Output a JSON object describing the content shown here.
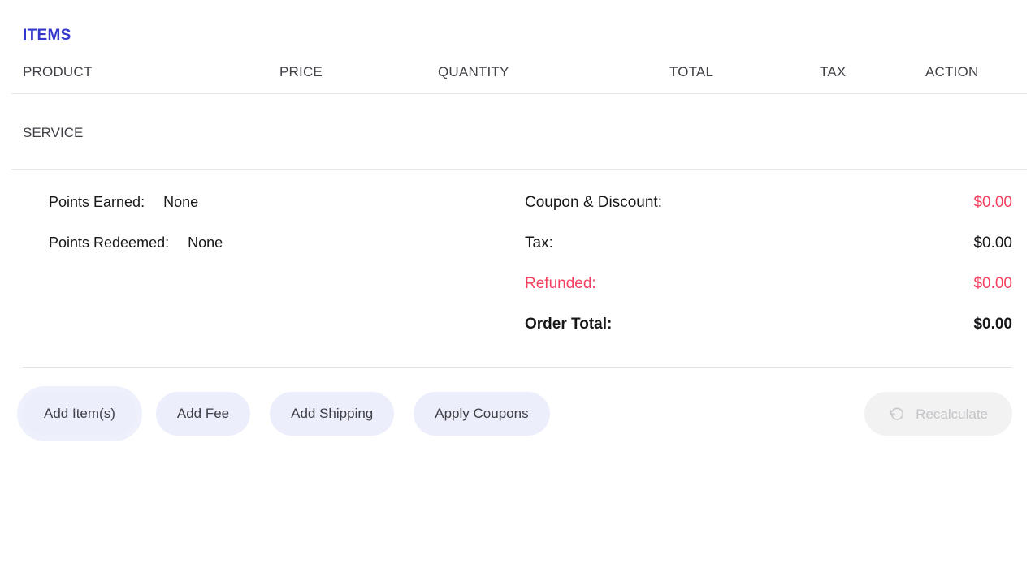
{
  "section": {
    "title": "ITEMS"
  },
  "table": {
    "headers": {
      "product": "PRODUCT",
      "price": "PRICE",
      "quantity": "QUANTITY",
      "total": "TOTAL",
      "tax": "TAX",
      "action": "ACTION"
    },
    "rows": [
      {
        "product": "SERVICE",
        "price": "",
        "quantity": "",
        "total": "",
        "tax": "",
        "action": ""
      }
    ]
  },
  "points": {
    "earned_label": "Points Earned:",
    "earned_value": "None",
    "redeemed_label": "Points Redeemed:",
    "redeemed_value": "None"
  },
  "totals": [
    {
      "label": "Coupon & Discount:",
      "value": "$0.00"
    },
    {
      "label": "Tax:",
      "value": "$0.00"
    },
    {
      "label": "Refunded:",
      "value": "$0.00"
    },
    {
      "label": "Order Total:",
      "value": "$0.00"
    }
  ],
  "actions": {
    "add_items": "Add Item(s)",
    "add_fee": "Add Fee",
    "add_shipping": "Add Shipping",
    "apply_coupons": "Apply Coupons",
    "recalculate": "Recalculate",
    "recalculate_icon": "rotate-ccw-icon"
  },
  "colors": {
    "heading": "#3538CD",
    "accent": "#F43F5E",
    "button_bg": "#ECEEFB",
    "button_disabled_bg": "#F2F2F3",
    "button_disabled_text": "#C4C4C8",
    "text": "#3F3F46",
    "divider": "#E8E8EC"
  }
}
